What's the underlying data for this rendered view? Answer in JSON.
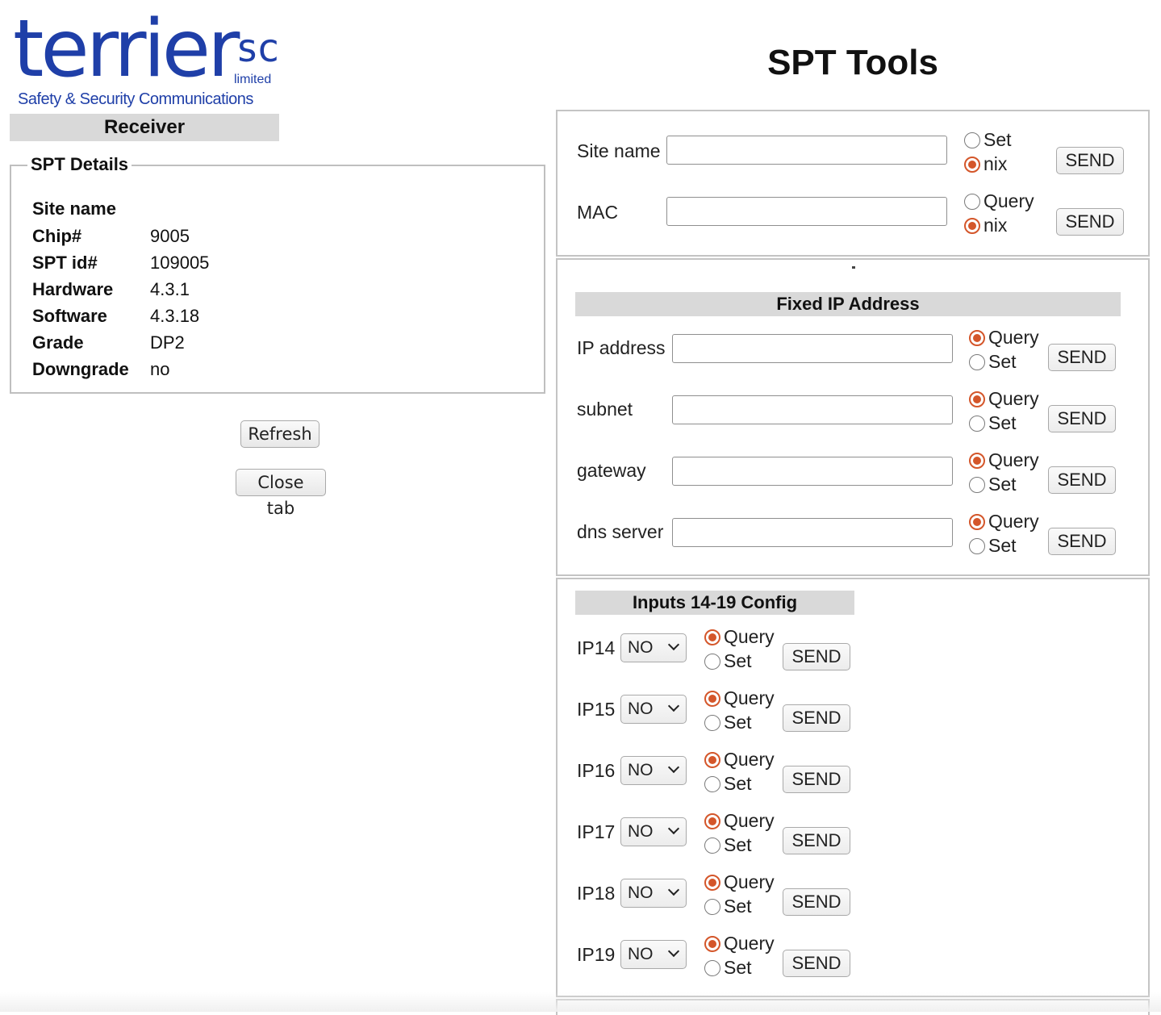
{
  "logo": {
    "word": "terrier",
    "sc": "sc",
    "limited": "limited",
    "tagline": "Safety & Security Communications"
  },
  "left": {
    "receiver_label": "Receiver",
    "details_legend": "SPT Details",
    "details": [
      {
        "key": "Site name",
        "value": ""
      },
      {
        "key": "Chip#",
        "value": "9005"
      },
      {
        "key": "SPT id#",
        "value": "109005"
      },
      {
        "key": "Hardware",
        "value": "4.3.1"
      },
      {
        "key": "Software",
        "value": "4.3.18"
      },
      {
        "key": "Grade",
        "value": "DP2"
      },
      {
        "key": "Downgrade",
        "value": "no"
      }
    ],
    "refresh_label": "Refresh",
    "close_tab_label": "Close tab"
  },
  "title": "SPT Tools",
  "site": {
    "site_name_label": "Site name",
    "site_name_value": "",
    "site_opt1": "Set",
    "site_opt2": "nix",
    "mac_label": "MAC",
    "mac_value": "",
    "mac_opt1": "Query",
    "mac_opt2": "nix",
    "send_label": "SEND"
  },
  "fixed_ip": {
    "heading": "Fixed IP Address",
    "rows": [
      {
        "label": "IP address",
        "value": "",
        "opt1": "Query",
        "opt2": "Set",
        "send": "SEND"
      },
      {
        "label": "subnet",
        "value": "",
        "opt1": "Query",
        "opt2": "Set",
        "send": "SEND"
      },
      {
        "label": "gateway",
        "value": "",
        "opt1": "Query",
        "opt2": "Set",
        "send": "SEND"
      },
      {
        "label": "dns server",
        "value": "",
        "opt1": "Query",
        "opt2": "Set",
        "send": "SEND"
      }
    ]
  },
  "inputs": {
    "heading": "Inputs 14-19 Config",
    "rows": [
      {
        "label": "IP14",
        "select": "NO",
        "opt1": "Query",
        "opt2": "Set",
        "send": "SEND"
      },
      {
        "label": "IP15",
        "select": "NO",
        "opt1": "Query",
        "opt2": "Set",
        "send": "SEND"
      },
      {
        "label": "IP16",
        "select": "NO",
        "opt1": "Query",
        "opt2": "Set",
        "send": "SEND"
      },
      {
        "label": "IP17",
        "select": "NO",
        "opt1": "Query",
        "opt2": "Set",
        "send": "SEND"
      },
      {
        "label": "IP18",
        "select": "NO",
        "opt1": "Query",
        "opt2": "Set",
        "send": "SEND"
      },
      {
        "label": "IP19",
        "select": "NO",
        "opt1": "Query",
        "opt2": "Set",
        "send": "SEND"
      }
    ]
  },
  "colors": {
    "logo_blue": "#1f3fa8",
    "radio_selected": "#d4562a",
    "section_bar": "#d9d9d9"
  }
}
